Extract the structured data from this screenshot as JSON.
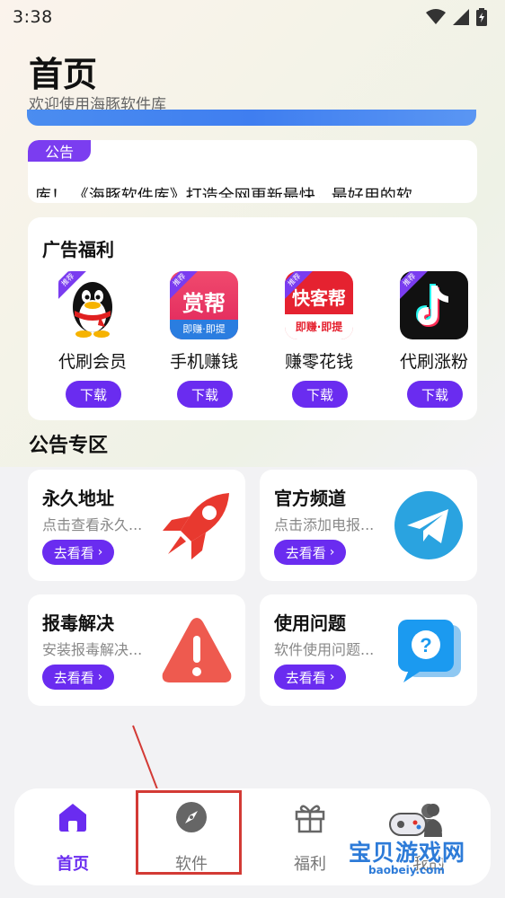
{
  "status_bar": {
    "time": "3:38"
  },
  "header": {
    "title": "首页",
    "subtitle": "欢迎使用海豚软件库"
  },
  "notice": {
    "badge": "公告",
    "text": "库！   《海豚软件库》打造全网更新最快，最好用的软"
  },
  "ads": {
    "title": "广告福利",
    "items": [
      {
        "name": "代刷会员",
        "button": "下载",
        "tag": "推荐",
        "icon": "qq-penguin-icon"
      },
      {
        "name": "手机赚钱",
        "button": "下载",
        "tag": "推荐",
        "icon_text": "赏帮",
        "icon_subtext": "即赚·即提",
        "icon": "money-app-icon"
      },
      {
        "name": "赚零花钱",
        "button": "下载",
        "tag": "推荐",
        "icon_text": "快客帮",
        "icon_subtext": "即赚·即提",
        "icon": "kuaikebang-icon"
      },
      {
        "name": "代刷涨粉",
        "button": "下载",
        "tag": "推荐",
        "icon": "tiktok-icon"
      }
    ]
  },
  "section": {
    "title": "公告专区"
  },
  "features": [
    {
      "title": "永久地址",
      "desc": "点击查看永久...",
      "button": "去看看",
      "icon": "rocket-icon"
    },
    {
      "title": "官方频道",
      "desc": "点击添加电报...",
      "button": "去看看",
      "icon": "telegram-icon"
    },
    {
      "title": "报毒解决",
      "desc": "安装报毒解决...",
      "button": "去看看",
      "icon": "warning-icon"
    },
    {
      "title": "使用问题",
      "desc": "软件使用问题...",
      "button": "去看看",
      "icon": "question-chat-icon"
    }
  ],
  "bottom_nav": {
    "items": [
      {
        "label": "首页",
        "icon": "home-icon",
        "active": true
      },
      {
        "label": "软件",
        "icon": "compass-icon",
        "active": false
      },
      {
        "label": "福利",
        "icon": "gift-icon",
        "active": false
      },
      {
        "label": "我的",
        "icon": "user-icon",
        "active": false
      }
    ]
  },
  "watermark": {
    "text": "宝贝游戏网",
    "url": "baobeiy.com"
  },
  "colors": {
    "accent": "#6a2cf0",
    "badge": "#7b3df0",
    "annotation": "#d33a35"
  }
}
